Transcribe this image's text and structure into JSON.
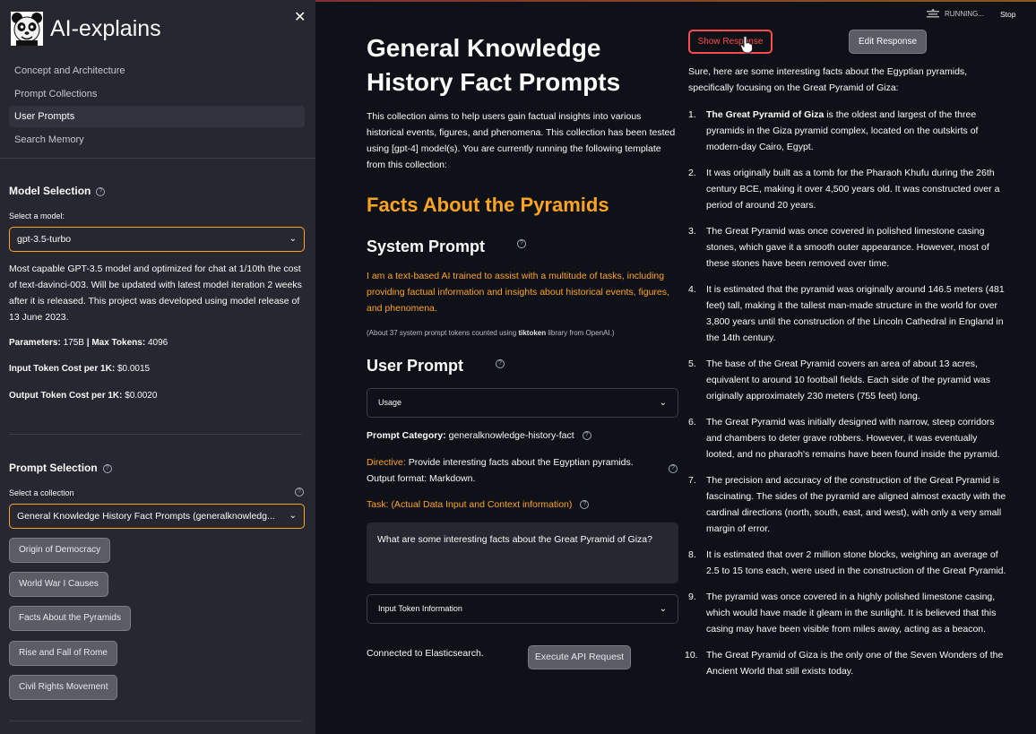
{
  "sidebar": {
    "app_title": "AI-explains",
    "nav": [
      {
        "label": "Concept and Architecture"
      },
      {
        "label": "Prompt Collections"
      },
      {
        "label": "User Prompts"
      },
      {
        "label": "Search Memory"
      }
    ],
    "model_section": {
      "title": "Model Selection",
      "select_label": "Select a model:",
      "selected_model": "gpt-3.5-turbo",
      "description": "Most capable GPT-3.5 model and optimized for chat at 1/10th the cost of text-davinci-003. Will be updated with latest model iteration 2 weeks after it is released. This project was developed using model release of 13 June 2023.",
      "params_label": "Parameters:",
      "params_value": "175B",
      "sep": "|",
      "max_tokens_label": "Max Tokens:",
      "max_tokens_value": "4096",
      "input_cost_label": "Input Token Cost per 1K:",
      "input_cost_value": "$0.0015",
      "output_cost_label": "Output Token Cost per 1K:",
      "output_cost_value": "$0.0020"
    },
    "prompt_section": {
      "title": "Prompt Selection",
      "select_label": "Select a collection",
      "selected_collection": "General Knowledge History Fact Prompts (generalknowledg...",
      "buttons": [
        {
          "label": "Origin of Democracy"
        },
        {
          "label": "World War I Causes"
        },
        {
          "label": "Facts About the Pyramids"
        },
        {
          "label": "Rise and Fall of Rome"
        },
        {
          "label": "Civil Rights Movement"
        }
      ]
    }
  },
  "status": {
    "running": "RUNNING...",
    "stop": "Stop"
  },
  "main": {
    "title": "General Knowledge History Fact Prompts",
    "intro": "This collection aims to help users gain factual insights into various historical events, figures, and phenomena. This collection has been tested using [gpt-4] model(s). You are currently running the following template from this collection:",
    "template_title": "Facts About the Pyramids",
    "system_prompt_heading": "System Prompt",
    "system_prompt": "I am a text-based AI trained to assist with a multitude of tasks, including providing factual information and insights about historical events, figures, and phenomena.",
    "token_note_pre": "(About 37 system prompt tokens counted using ",
    "token_note_bold": "tiktoken",
    "token_note_post": " library from OpenAI.)",
    "user_prompt_heading": "User Prompt",
    "usage_label": "Usage",
    "category_label": "Prompt Category:",
    "category_value": "generalknowledge-history-fact",
    "directive_label": "Directive:",
    "directive_value": "Provide interesting facts about the Egyptian pyramids.",
    "output_format": "Output format: Markdown.",
    "task_label": "Task:",
    "task_hint": "(Actual Data Input and Context information)",
    "task_value": "What are some interesting facts about the Great Pyramid of Giza?",
    "input_token_info": "Input Token Information",
    "connection_status": "Connected to Elasticsearch.",
    "execute_label": "Execute API Request"
  },
  "response": {
    "show_label": "Show Response",
    "edit_label": "Edit Response",
    "intro": "Sure, here are some interesting facts about the Egyptian pyramids, specifically focusing on the Great Pyramid of Giza:",
    "facts": [
      {
        "n": "1.",
        "bold": "The Great Pyramid of Giza",
        "text": " is the oldest and largest of the three pyramids in the Giza pyramid complex, located on the outskirts of modern-day Cairo, Egypt."
      },
      {
        "n": "2.",
        "bold": "",
        "text": "It was originally built as a tomb for the Pharaoh Khufu during the 26th century BCE, making it over 4,500 years old. It was constructed over a period of around 20 years."
      },
      {
        "n": "3.",
        "bold": "",
        "text": "The Great Pyramid was once covered in polished limestone casing stones, which gave it a smooth outer appearance. However, most of these stones have been removed over time."
      },
      {
        "n": "4.",
        "bold": "",
        "text": "It is estimated that the pyramid was originally around 146.5 meters (481 feet) tall, making it the tallest man-made structure in the world for over 3,800 years until the construction of the Lincoln Cathedral in England in the 14th century."
      },
      {
        "n": "5.",
        "bold": "",
        "text": "The base of the Great Pyramid covers an area of about 13 acres, equivalent to around 10 football fields. Each side of the pyramid was originally approximately 230 meters (755 feet) long."
      },
      {
        "n": "6.",
        "bold": "",
        "text": "The Great Pyramid was initially designed with narrow, steep corridors and chambers to deter grave robbers. However, it was eventually looted, and no pharaoh's remains have been found inside the pyramid."
      },
      {
        "n": "7.",
        "bold": "",
        "text": "The precision and accuracy of the construction of the Great Pyramid is fascinating. The sides of the pyramid are aligned almost exactly with the cardinal directions (north, south, east, and west), with only a very small margin of error."
      },
      {
        "n": "8.",
        "bold": "",
        "text": "It is estimated that over 2 million stone blocks, weighing an average of 2.5 to 15 tons each, were used in the construction of the Great Pyramid."
      },
      {
        "n": "9.",
        "bold": "",
        "text": "The pyramid was once covered in a highly polished limestone casing, which would have made it gleam in the sunlight. It is believed that this casing may have been visible from miles away, acting as a beacon."
      },
      {
        "n": "10.",
        "bold": "",
        "text": "The Great Pyramid of Giza is the only one of the Seven Wonders of the Ancient World that still exists today."
      }
    ]
  }
}
